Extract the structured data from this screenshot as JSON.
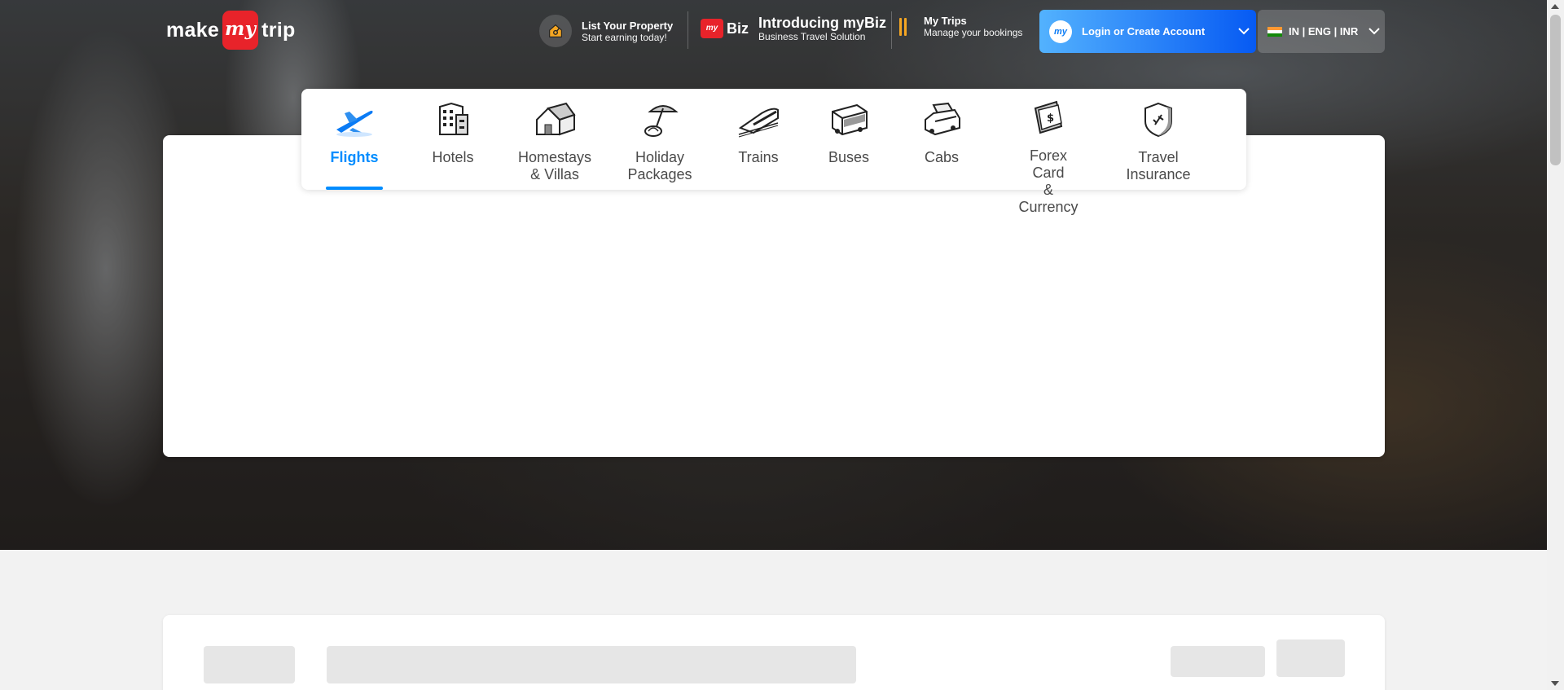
{
  "header": {
    "logo": {
      "left": "make",
      "mid": "my",
      "right": "trip"
    },
    "list_property": {
      "title": "List Your Property",
      "subtitle": "Start earning today!",
      "icon": "house-tag-icon"
    },
    "mybiz": {
      "badge": "my",
      "badge_text": "Biz",
      "title": "Introducing myBiz",
      "subtitle": "Business Travel Solution"
    },
    "my_trips": {
      "title": "My Trips",
      "subtitle": "Manage your bookings",
      "icon": "suitcase-icon"
    },
    "login": {
      "label": "Login or Create Account",
      "icon_text": "my"
    },
    "locale": {
      "label": "IN | ENG | INR"
    }
  },
  "nav": {
    "tabs": [
      {
        "label": "Flights",
        "icon": "flight-icon",
        "active": true
      },
      {
        "label": "Hotels",
        "icon": "hotel-icon",
        "active": false
      },
      {
        "label": "Homestays\n& Villas",
        "icon": "homestay-icon",
        "active": false
      },
      {
        "label": "Holiday\nPackages",
        "icon": "holiday-icon",
        "active": false
      },
      {
        "label": "Trains",
        "icon": "train-icon",
        "active": false
      },
      {
        "label": "Buses",
        "icon": "bus-icon",
        "active": false
      },
      {
        "label": "Cabs",
        "icon": "cab-icon",
        "active": false
      },
      {
        "label": "Forex Card\n& Currency",
        "icon": "forex-icon",
        "active": false
      },
      {
        "label": "Travel\nInsurance",
        "icon": "insurance-icon",
        "active": false
      }
    ]
  },
  "colors": {
    "accent": "#008cff",
    "brand_red": "#e8232a",
    "login_gradient_start": "#53b2fe",
    "login_gradient_end": "#065af3",
    "trips_icon": "#f5a623"
  }
}
